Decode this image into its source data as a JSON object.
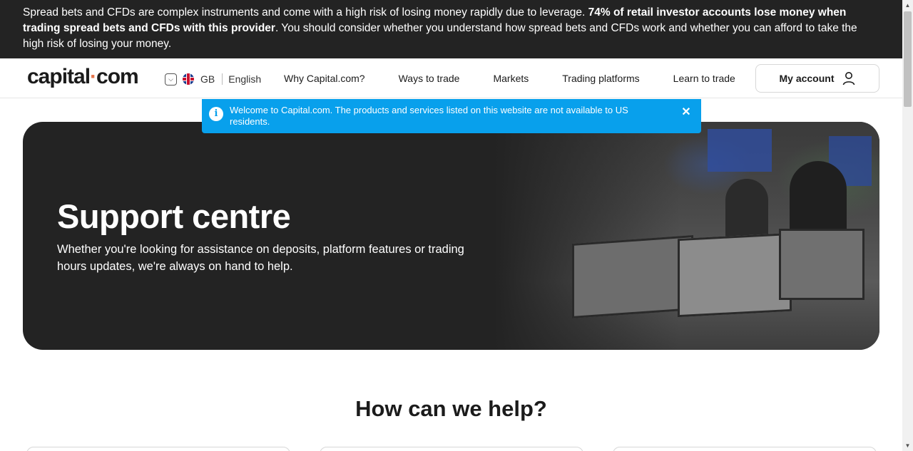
{
  "risk_warning": {
    "text_start": "Spread bets and CFDs are complex instruments and come with a high risk of losing money rapidly due to leverage. ",
    "text_bold": "74% of retail investor accounts lose money when trading spread bets and CFDs with this provider",
    "text_end": ". You should consider whether you understand how spread bets and CFDs work and whether you can afford to take the high risk of losing your money."
  },
  "header": {
    "logo_left": "capital",
    "logo_dot": "·",
    "logo_right": "com",
    "region_code": "GB",
    "language": "English",
    "nav": [
      "Why Capital.com?",
      "Ways to trade",
      "Markets",
      "Trading platforms",
      "Learn to trade"
    ],
    "account_label": "My account"
  },
  "notice": {
    "info_glyph": "i",
    "text": "Welcome to Capital.com. The products and services listed on this website are not available to US residents.",
    "close_glyph": "✕"
  },
  "hero": {
    "title": "Support centre",
    "description": "Whether you're looking for assistance on deposits, platform features or trading hours updates, we're always on hand to help."
  },
  "help": {
    "title": "How can we help?"
  },
  "colors": {
    "dark_bg": "#232323",
    "notice_blue": "#08a0ec",
    "logo_accent": "#e6744a"
  }
}
